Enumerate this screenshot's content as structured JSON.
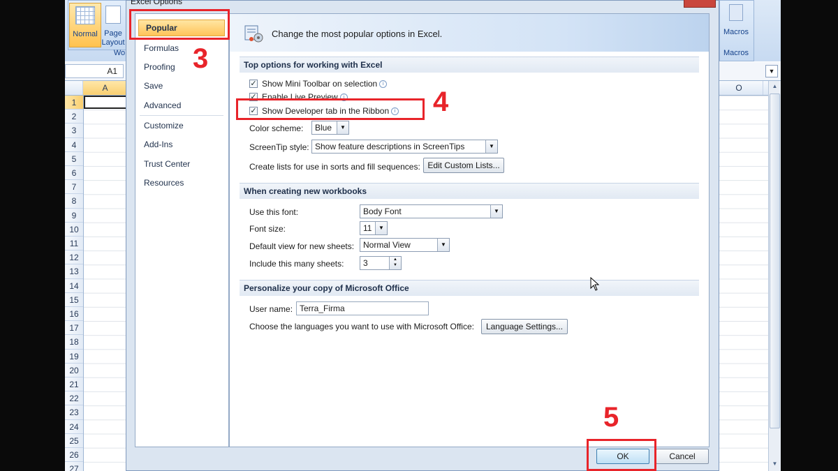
{
  "dialog": {
    "title": "Excel Options",
    "sidebar": [
      {
        "label": "Popular",
        "active": true
      },
      {
        "label": "Formulas"
      },
      {
        "label": "Proofing"
      },
      {
        "label": "Save"
      },
      {
        "label": "Advanced"
      },
      {
        "label": "Customize"
      },
      {
        "label": "Add-Ins"
      },
      {
        "label": "Trust Center"
      },
      {
        "label": "Resources"
      }
    ],
    "header_title": "Change the most popular options in Excel.",
    "sections": {
      "top": "Top options for working with Excel",
      "new_workbooks": "When creating new workbooks",
      "personalize": "Personalize your copy of Microsoft Office"
    },
    "options": {
      "mini_toolbar": {
        "label": "Show Mini Toolbar on selection",
        "checked": true
      },
      "live_preview": {
        "label": "Enable Live Preview",
        "checked": true
      },
      "developer_tab": {
        "label": "Show Developer tab in the Ribbon",
        "checked": true
      },
      "color_scheme": {
        "label": "Color scheme:",
        "value": "Blue"
      },
      "screentip": {
        "label": "ScreenTip style:",
        "value": "Show feature descriptions in ScreenTips"
      },
      "custom_lists": {
        "label": "Create lists for use in sorts and fill sequences:",
        "button": "Edit Custom Lists..."
      },
      "font": {
        "label": "Use this font:",
        "value": "Body Font"
      },
      "font_size": {
        "label": "Font size:",
        "value": "11"
      },
      "default_view": {
        "label": "Default view for new sheets:",
        "value": "Normal View"
      },
      "sheets": {
        "label": "Include this many sheets:",
        "value": "3"
      },
      "user_name": {
        "label": "User name:",
        "value": "Terra_Firma"
      },
      "languages": {
        "label": "Choose the languages you want to use with Microsoft Office:",
        "button": "Language Settings..."
      }
    },
    "ok_label": "OK",
    "cancel_label": "Cancel"
  },
  "excel": {
    "ribbon": {
      "normal": "Normal",
      "page_layout": "Page Layout",
      "group_partial": "Wo",
      "macros": "Macros",
      "macros_group": "Macros"
    },
    "name_box": "A1",
    "columns": [
      "A",
      "O"
    ],
    "rows": [
      "1",
      "2",
      "3",
      "4",
      "5",
      "6",
      "7",
      "8",
      "9",
      "10",
      "11",
      "12",
      "13",
      "14",
      "15",
      "16",
      "17",
      "18",
      "19",
      "20",
      "21",
      "22",
      "23",
      "24",
      "25",
      "26",
      "27"
    ]
  },
  "annotations": {
    "step3": "3",
    "step4": "4",
    "step5": "5"
  },
  "colors": {
    "highlight_red": "#e8242a",
    "active_item": "#ffc459",
    "dialog_bg": "#dbe5f1"
  }
}
